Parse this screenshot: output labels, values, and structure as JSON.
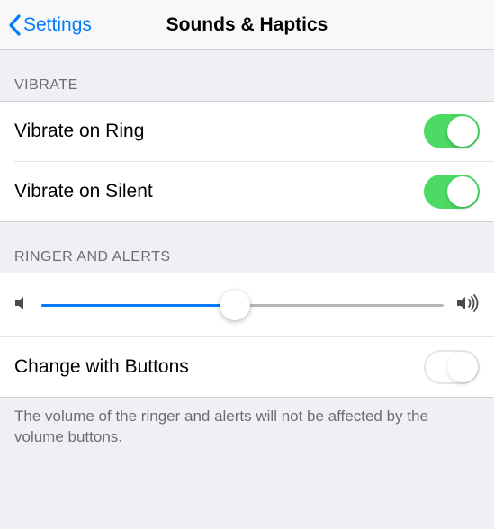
{
  "nav": {
    "back_label": "Settings",
    "title": "Sounds & Haptics"
  },
  "sections": {
    "vibrate": {
      "header": "Vibrate",
      "rows": [
        {
          "label": "Vibrate on Ring",
          "value": true
        },
        {
          "label": "Vibrate on Silent",
          "value": true
        }
      ]
    },
    "ringer": {
      "header": "Ringer and Alerts",
      "volume_percent": 48,
      "change_with_buttons": {
        "label": "Change with Buttons",
        "value": false
      },
      "footer": "The volume of the ringer and alerts will not be affected by the volume buttons."
    }
  },
  "icons": {
    "back_chevron": "chevron-left-icon",
    "volume_min": "volume-min-icon",
    "volume_max": "volume-max-icon"
  },
  "colors": {
    "tint": "#007aff",
    "switch_on": "#4cd964",
    "background": "#efeff4"
  }
}
